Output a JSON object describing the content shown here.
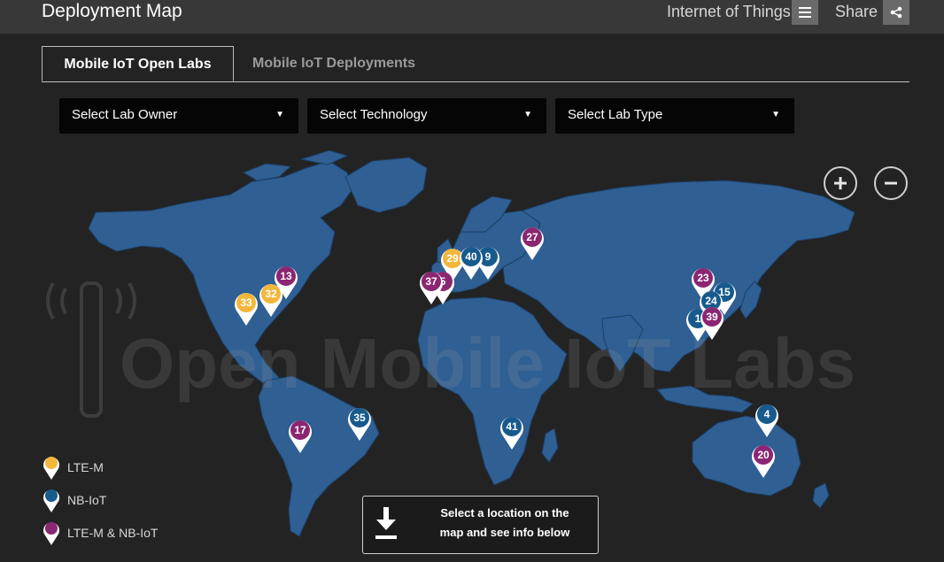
{
  "header": {
    "title": "Deployment Map",
    "nav_label": "Internet of Things",
    "menu_icon": "menu-icon",
    "share_label": "Share",
    "share_icon": "share-icon"
  },
  "tabs": [
    {
      "label": "Mobile IoT Open Labs",
      "active": true
    },
    {
      "label": "Mobile IoT Deployments",
      "active": false
    }
  ],
  "filters": [
    {
      "label": "Select Lab Owner"
    },
    {
      "label": "Select Technology"
    },
    {
      "label": "Select Lab Type"
    }
  ],
  "colors": {
    "lte_m": "#f2b63a",
    "nb_iot": "#175a8c",
    "both": "#8b2672",
    "land": "#2f5f93",
    "borders": "#1c3f66"
  },
  "watermark": "Open Mobile IoT Labs",
  "zoom": {
    "in_icon": "plus-icon",
    "out_icon": "minus-icon"
  },
  "legend": [
    {
      "label": "LTE-M",
      "type": "lte_m"
    },
    {
      "label": "NB-IoT",
      "type": "nb_iot"
    },
    {
      "label": "LTE-M & NB-IoT",
      "type": "both"
    }
  ],
  "info": {
    "icon": "download-icon",
    "line1": "Select a location on the",
    "line2": "map and see info below"
  },
  "markers": [
    {
      "label": "33",
      "type": "lte_m",
      "region": "Western USA"
    },
    {
      "label": "32",
      "type": "lte_m",
      "region": "Central USA"
    },
    {
      "label": "13",
      "type": "both",
      "region": "Eastern USA"
    },
    {
      "label": "17",
      "type": "both",
      "region": "Chile"
    },
    {
      "label": "35",
      "type": "nb_iot",
      "region": "Brazil"
    },
    {
      "label": "37",
      "type": "both",
      "region": "Spain"
    },
    {
      "label": "40",
      "type": "nb_iot",
      "region": "Central Europe"
    },
    {
      "label": "27",
      "type": "both",
      "region": "Russia"
    },
    {
      "label": "41",
      "type": "nb_iot",
      "region": "South Africa"
    },
    {
      "label": "23",
      "type": "both",
      "region": "China"
    },
    {
      "label": "15",
      "type": "nb_iot",
      "region": "Korea"
    },
    {
      "label": "24",
      "type": "nb_iot",
      "region": "China"
    },
    {
      "label": "39",
      "type": "both",
      "region": "Taiwan"
    },
    {
      "label": "4",
      "type": "nb_iot",
      "region": "Australia"
    },
    {
      "label": "20",
      "type": "both",
      "region": "Australia"
    },
    {
      "label": "29",
      "type": "lte_m",
      "region": "UK"
    },
    {
      "label": "5",
      "type": "both",
      "region": "France"
    },
    {
      "label": "9",
      "type": "nb_iot",
      "region": "Germany"
    },
    {
      "label": "1",
      "type": "nb_iot",
      "region": "Hong Kong"
    }
  ]
}
